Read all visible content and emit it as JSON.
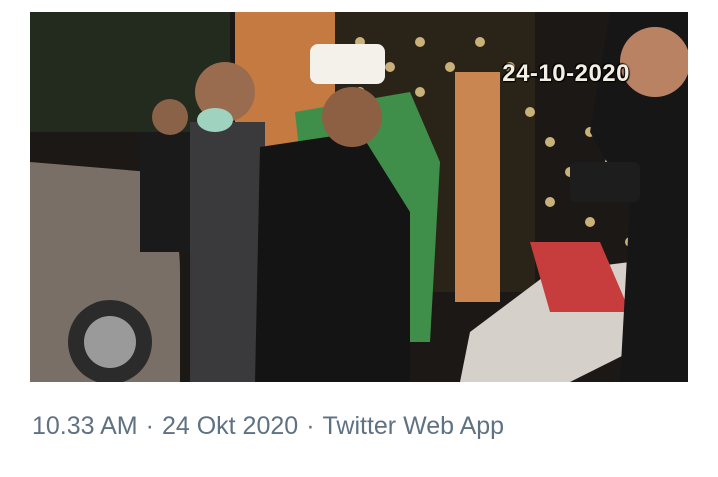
{
  "media": {
    "timestamp_overlay": "24-10-2020"
  },
  "tweet_meta": {
    "time": "10.33 AM",
    "separator": "·",
    "date": "24 Okt 2020",
    "source": "Twitter Web App",
    "source_link_color": "#5f7284"
  },
  "colors": {
    "meta_text": "#5f7284",
    "background": "#ffffff"
  }
}
